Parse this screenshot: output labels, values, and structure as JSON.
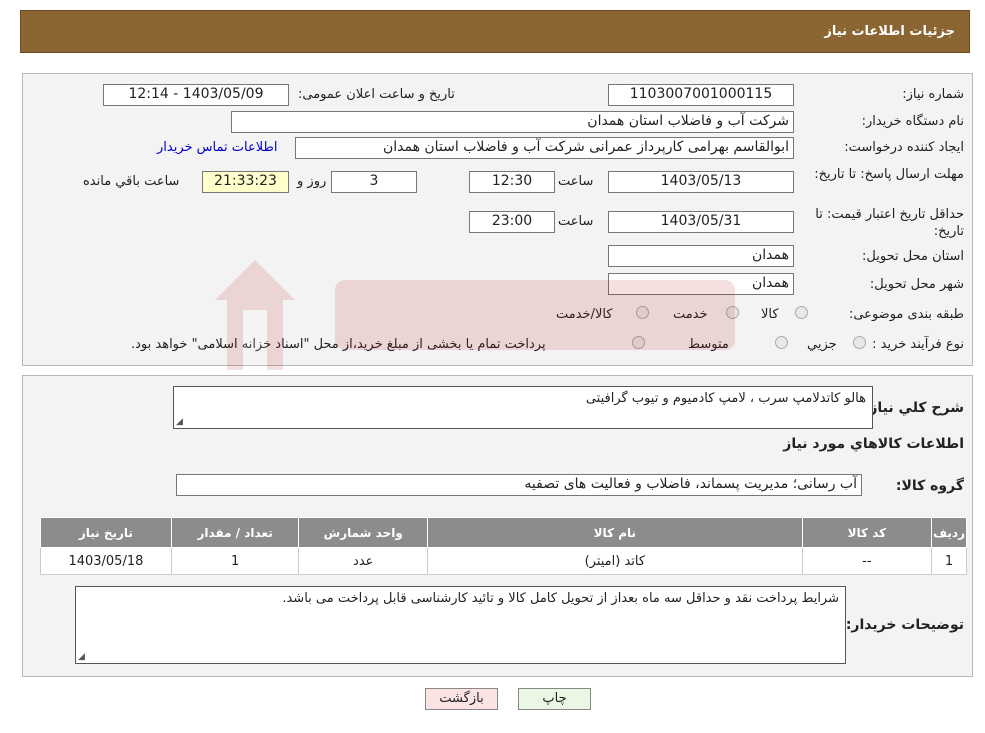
{
  "header": {
    "title": "جزئیات اطلاعات نیاز"
  },
  "form": {
    "need_number": {
      "label": "شماره نیاز:",
      "value": "1103007001000115"
    },
    "announce_datetime": {
      "label": "تاریخ و ساعت اعلان عمومی:",
      "value": "1403/05/09 - 12:14"
    },
    "buyer_org": {
      "label": "نام دستگاه خریدار:",
      "value": "شرکت آب و فاضلاب استان همدان"
    },
    "requester": {
      "label": "ایجاد کننده درخواست:",
      "value": "ابوالقاسم بهرامی کارپرداز عمرانی شرکت آب و فاضلاب استان همدان",
      "contact_link": "اطلاعات تماس خریدار"
    },
    "reply_deadline": {
      "label": "مهلت ارسال پاسخ: تا تاریخ:",
      "date": "1403/05/13",
      "time_label": "ساعت",
      "time": "12:30",
      "days": "3",
      "days_label": "روز و",
      "remaining": "21:33:23",
      "remaining_label": "ساعت باقي مانده"
    },
    "price_validity": {
      "label": "حداقل تاریخ اعتبار قیمت: تا تاریخ:",
      "date": "1403/05/31",
      "time_label": "ساعت",
      "time": "23:00"
    },
    "delivery_province": {
      "label": "استان محل تحویل:",
      "value": "همدان"
    },
    "delivery_city": {
      "label": "شهر محل تحویل:",
      "value": "همدان"
    },
    "category": {
      "label": "طبقه بندی موضوعی:",
      "options": [
        "کالا",
        "خدمت",
        "کالا/خدمت"
      ]
    },
    "process_type": {
      "label": "نوع فرآیند خرید :",
      "options": [
        "جزیي",
        "متوسط"
      ],
      "note": "پرداخت تمام یا بخشی از مبلغ خرید،از محل \"اسناد خزانه اسلامی\" خواهد بود."
    }
  },
  "details": {
    "description_label": "شرح کلي نياز:",
    "description": "هالو کاتدلامپ سرب ، لامپ کادمیوم و تیوب گرافیتی",
    "goods_info_title": "اطلاعات کالاهاي مورد نياز",
    "goods_group_label": "گروه کالا:",
    "goods_group": "آب رسانی؛ مدیریت پسماند، فاضلاب و فعالیت های تصفیه",
    "table": {
      "headers": [
        "رديف",
        "کد کالا",
        "نام کالا",
        "واحد شمارش",
        "تعداد / مقدار",
        "تاریخ نیاز"
      ],
      "rows": [
        [
          "1",
          "--",
          "کاتد (امیتر)",
          "عدد",
          "1",
          "1403/05/18"
        ]
      ]
    },
    "buyer_notes_label": "توضیحات خریدار:",
    "buyer_notes": "شرایط پرداخت  نقد و حداقل سه ماه بعداز از تحویل کامل کالا  و تائید کارشناسی قابل پرداخت می باشد."
  },
  "buttons": {
    "print": "چاپ",
    "back": "بازگشت"
  }
}
